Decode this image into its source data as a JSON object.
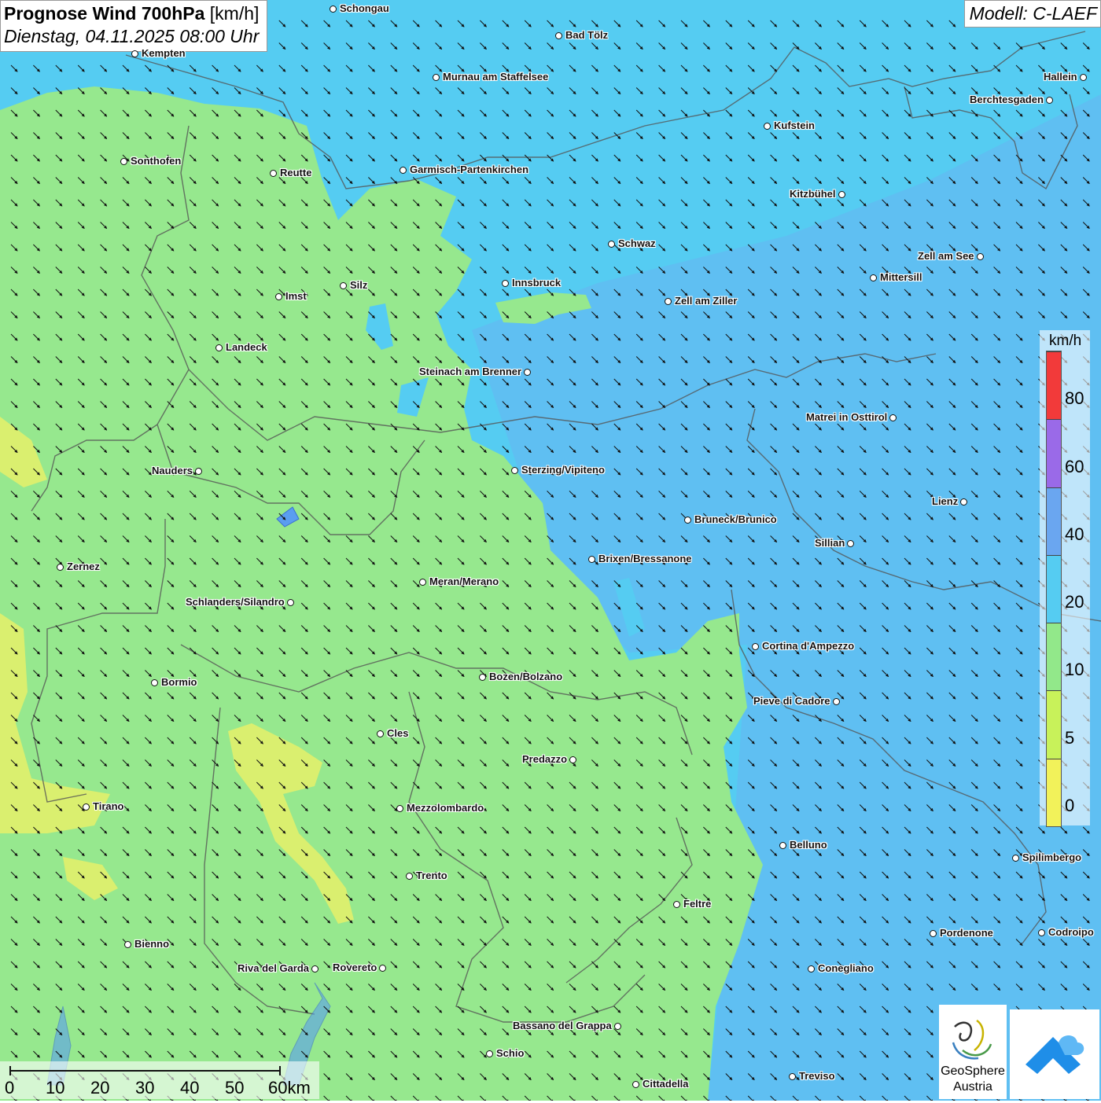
{
  "title": {
    "bold": "Prognose Wind 700hPa",
    "unit": "[km/h]",
    "date": "Dienstag, 04.11.2025 08:00 Uhr"
  },
  "model": "Modell: C-LAEF",
  "colors": {
    "yellow": "#f2f25a",
    "green_light": "#92e88a",
    "cyan": "#55ccf2",
    "blue": "#6aa6f0",
    "violet": "#9a6ae8",
    "red": "#f23a3a"
  },
  "legend": {
    "unit": "km/h",
    "labels": [
      "80",
      "60",
      "40",
      "20",
      "10",
      "5",
      "0"
    ]
  },
  "scalebar": {
    "ticks": [
      "0",
      "10",
      "20",
      "30",
      "40",
      "50",
      "60km"
    ]
  },
  "logos": {
    "geosphere_line1": "GeoSphere",
    "geosphere_line2": "Austria",
    "geosphere_icon": "geosphere-swirl-icon",
    "second_icon": "blue-arrow-cloud-icon"
  },
  "cities": [
    {
      "name": "Schongau"
    },
    {
      "name": "Bad Tölz"
    },
    {
      "name": "Kempten"
    },
    {
      "name": "Murnau am Staffelsee"
    },
    {
      "name": "Hallein"
    },
    {
      "name": "Berchtesgaden"
    },
    {
      "name": "Kufstein"
    },
    {
      "name": "Sonthofen"
    },
    {
      "name": "Reutte"
    },
    {
      "name": "Garmisch-Partenkirchen"
    },
    {
      "name": "Kitzbühel"
    },
    {
      "name": "Schwaz"
    },
    {
      "name": "Zell am See"
    },
    {
      "name": "Innsbruck"
    },
    {
      "name": "Mittersill"
    },
    {
      "name": "Silz"
    },
    {
      "name": "Imst"
    },
    {
      "name": "Zell am Ziller"
    },
    {
      "name": "Landeck"
    },
    {
      "name": "Steinach am Brenner"
    },
    {
      "name": "Matrei in Osttirol"
    },
    {
      "name": "Nauders"
    },
    {
      "name": "Sterzing/Vipiteno"
    },
    {
      "name": "Lienz"
    },
    {
      "name": "Bruneck/Brunico"
    },
    {
      "name": "Sillian"
    },
    {
      "name": "Brixen/Bressanone"
    },
    {
      "name": "Zernez"
    },
    {
      "name": "Meran/Merano"
    },
    {
      "name": "Schlanders/Silandro"
    },
    {
      "name": "Cortina d'Ampezzo"
    },
    {
      "name": "Bozen/Bolzano"
    },
    {
      "name": "Bormio"
    },
    {
      "name": "Pieve di Cadore"
    },
    {
      "name": "Cles"
    },
    {
      "name": "Predazzo"
    },
    {
      "name": "Tirano"
    },
    {
      "name": "Mezzolombardo"
    },
    {
      "name": "Belluno"
    },
    {
      "name": "Spilimbergo"
    },
    {
      "name": "Trento"
    },
    {
      "name": "Feltre"
    },
    {
      "name": "Bienno"
    },
    {
      "name": "Pordenone"
    },
    {
      "name": "Codroipo"
    },
    {
      "name": "Riva del Garda"
    },
    {
      "name": "Rovereto"
    },
    {
      "name": "Conegliano"
    },
    {
      "name": "Bassano del Grappa"
    },
    {
      "name": "Schio"
    },
    {
      "name": "Treviso"
    },
    {
      "name": "Cittadella"
    }
  ]
}
